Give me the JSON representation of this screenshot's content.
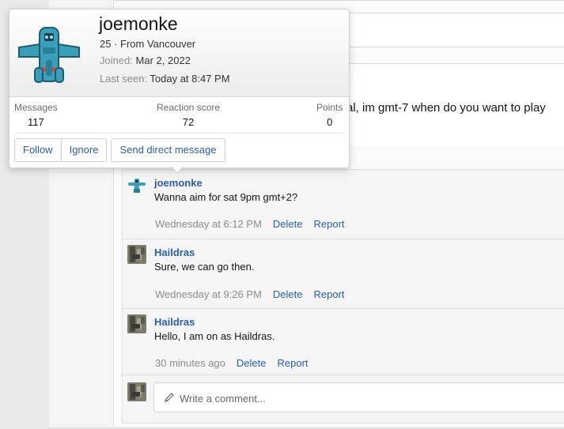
{
  "profile_card": {
    "username": "joemonke",
    "age_location": "25 · From Vancouver",
    "joined_label": "Joined:",
    "joined_value": "Mar 2, 2022",
    "last_seen_label": "Last seen:",
    "last_seen_value": "Today at 8:47 PM",
    "stats": [
      {
        "label": "Messages",
        "value": "117"
      },
      {
        "label": "Reaction score",
        "value": "72"
      },
      {
        "label": "Points",
        "value": "0"
      }
    ],
    "buttons": {
      "follow": "Follow",
      "ignore": "Ignore",
      "message": "Send direct message"
    }
  },
  "post": {
    "text_fragment": "al, im gmt-7 when do you want to play"
  },
  "comments": [
    {
      "author": "joemonke",
      "body": "Wanna aim for sat 9pm gmt+2?",
      "time": "Wednesday at 6:12 PM",
      "delete": "Delete",
      "report": "Report"
    },
    {
      "author": "Haildras",
      "body": "Sure, we can go then.",
      "time": "Wednesday at 9:26 PM",
      "delete": "Delete",
      "report": "Report"
    },
    {
      "author": "Haildras",
      "body": "Hello, I am on as Haildras.",
      "time": "30 minutes ago",
      "delete": "Delete",
      "report": "Report"
    }
  ],
  "comment_input": {
    "placeholder": "Write a comment..."
  },
  "colors": {
    "link": "#2a5ea8",
    "muted": "#8c8c8c",
    "avatar_teal": "#3a9fb8"
  }
}
